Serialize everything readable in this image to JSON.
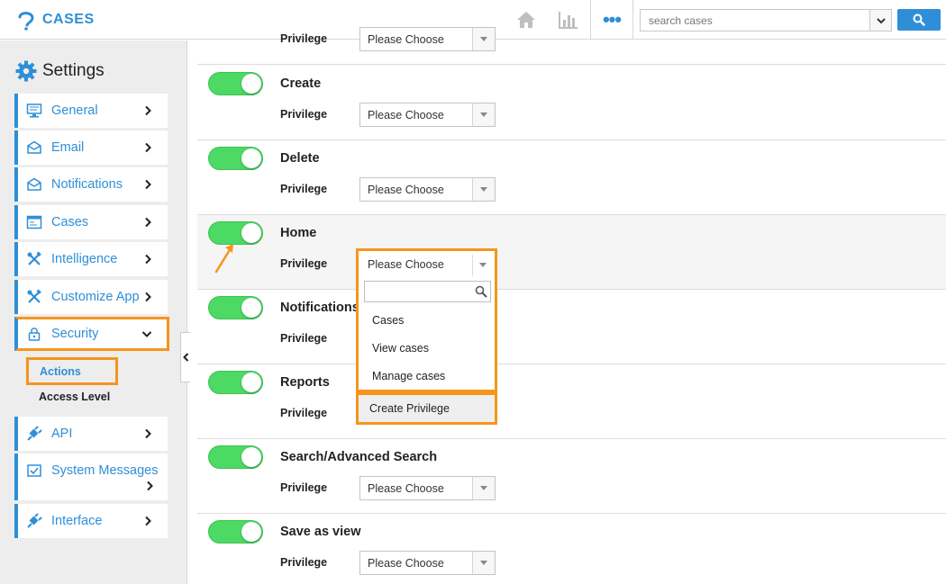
{
  "app": {
    "name": "CASES"
  },
  "search": {
    "placeholder": "search cases"
  },
  "sidebar": {
    "title": "Settings",
    "items": [
      {
        "label": "General"
      },
      {
        "label": "Email"
      },
      {
        "label": "Notifications"
      },
      {
        "label": "Cases"
      },
      {
        "label": "Intelligence"
      },
      {
        "label": "Customize App"
      },
      {
        "label": "Security"
      },
      {
        "label": "API"
      },
      {
        "label": "System Messages"
      },
      {
        "label": "Interface"
      }
    ],
    "security_sub": {
      "actions": "Actions",
      "access_level": "Access Level"
    }
  },
  "rows": [
    {
      "title": "",
      "privilege_label": "Privilege",
      "select_value": "Please Choose"
    },
    {
      "title": "Create",
      "privilege_label": "Privilege",
      "select_value": "Please Choose"
    },
    {
      "title": "Delete",
      "privilege_label": "Privilege",
      "select_value": "Please Choose"
    },
    {
      "title": "Home",
      "privilege_label": "Privilege",
      "select_value": "Please Choose"
    },
    {
      "title": "Notifications",
      "privilege_label": "Privilege",
      "select_value": ""
    },
    {
      "title": "Reports",
      "privilege_label": "Privilege",
      "select_value": ""
    },
    {
      "title": "Search/Advanced Search",
      "privilege_label": "Privilege",
      "select_value": "Please Choose"
    },
    {
      "title": "Save as view",
      "privilege_label": "Privilege",
      "select_value": "Please Choose"
    }
  ],
  "dropdown": {
    "selected": "Please Choose",
    "options": [
      "Cases",
      "View cases",
      "Manage cases"
    ],
    "create_label": "Create Privilege"
  },
  "colors": {
    "accent": "#2e8fd8",
    "highlight": "#f7941d",
    "toggle_on": "#4cd964"
  }
}
